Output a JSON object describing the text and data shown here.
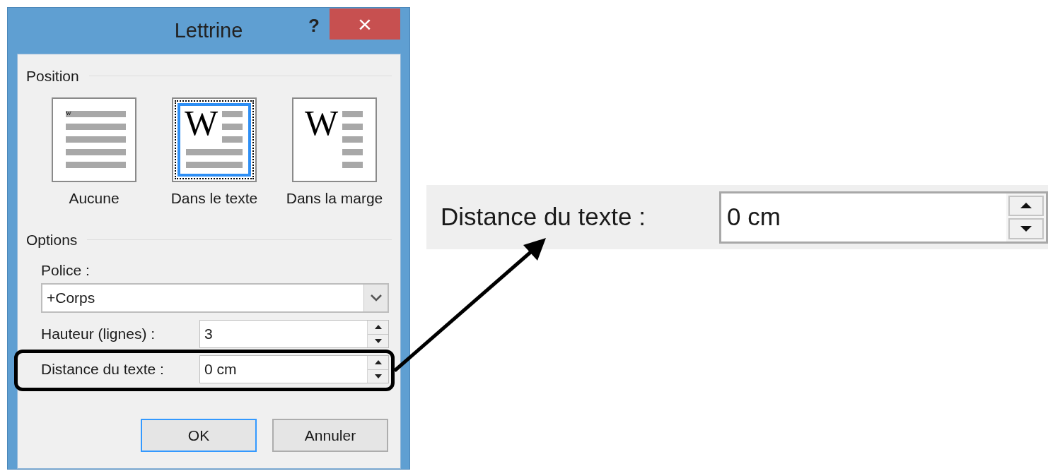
{
  "dialog": {
    "title": "Lettrine",
    "help_button": "?",
    "close_button": "×",
    "position": {
      "label": "Position",
      "options": [
        {
          "label": "Aucune",
          "kind": "none",
          "glyph": "w",
          "selected": false
        },
        {
          "label": "Dans le texte",
          "kind": "dropped",
          "glyph": "W",
          "selected": true
        },
        {
          "label": "Dans la marge",
          "kind": "margin",
          "glyph": "W",
          "selected": false
        }
      ]
    },
    "options": {
      "label": "Options",
      "font": {
        "label": "Police :",
        "value": "+Corps"
      },
      "height": {
        "label": "Hauteur (lignes) :",
        "value": "3"
      },
      "distance": {
        "label": "Distance du texte :",
        "value": "0 cm"
      }
    },
    "buttons": [
      {
        "label": "OK",
        "default": true
      },
      {
        "label": "Annuler",
        "default": false
      }
    ]
  },
  "zoom_callout": {
    "label": "Distance du texte :",
    "value": "0 cm"
  }
}
